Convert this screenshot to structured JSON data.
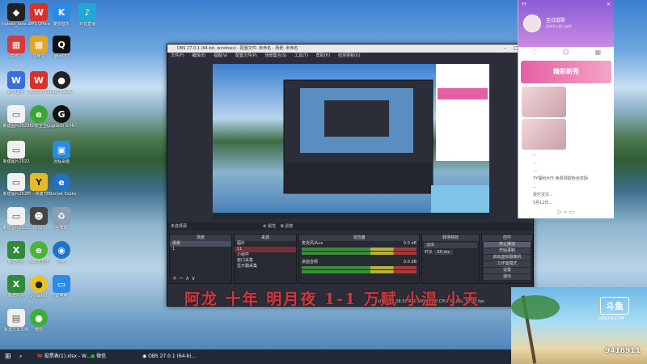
{
  "desktop": {
    "icons": [
      {
        "label": "tiglads_bota...",
        "glyph": "◆",
        "color": "#222222"
      },
      {
        "label": "WPS Office",
        "glyph": "W",
        "color": "#d7312a"
      },
      {
        "label": "酷狗音乐",
        "glyph": "K",
        "color": "#2a8ae6"
      },
      {
        "label": "抖音直播",
        "glyph": "♪",
        "color": "#1fa9d6"
      },
      {
        "label": "在线...",
        "glyph": "▦",
        "color": "#d83a3a"
      },
      {
        "label": "应用宝",
        "glyph": "▦",
        "color": "#e0a52a"
      },
      {
        "label": "腾讯QQ",
        "glyph": "Q",
        "color": "#111111"
      },
      {
        "label": "WPS图片",
        "glyph": "W",
        "color": "#3a6ed8"
      },
      {
        "label": "WPS Office",
        "glyph": "W",
        "color": "#d7312a"
      },
      {
        "label": "OBS Studio",
        "glyph": "●",
        "color": "#222222"
      },
      {
        "label": "新建图片2022",
        "glyph": "▭",
        "color": "#f1f1f1"
      },
      {
        "label": "360安全卫士",
        "glyph": "e",
        "color": "#3ca635"
      },
      {
        "label": "Logitech G HUB",
        "glyph": "G",
        "color": "#111111"
      },
      {
        "label": "新建图片2022",
        "glyph": "▭",
        "color": "#f1f1f1"
      },
      {
        "label": "远程桌面",
        "glyph": "▣",
        "color": "#2a8ae6"
      },
      {
        "label": "新建图片2022",
        "glyph": "▭",
        "color": "#f1f1f1"
      },
      {
        "label": "YY - 快捷方式",
        "glyph": "Y",
        "color": "#e6b92a"
      },
      {
        "label": "Internet Explorer",
        "glyph": "e",
        "color": "#1f72c6"
      },
      {
        "label": "新建图片2022",
        "glyph": "▭",
        "color": "#f1f1f1"
      },
      {
        "label": "Origin",
        "glyph": "☻",
        "color": "#444444"
      },
      {
        "label": "回收站",
        "glyph": "🗑",
        "color": "#8aa0b6"
      },
      {
        "label": "新建图片",
        "glyph": "X",
        "color": "#2e8b3a"
      },
      {
        "label": "360浏览器",
        "glyph": "e",
        "color": "#4ab43a"
      },
      {
        "label": "网络",
        "glyph": "◉",
        "color": "#1f72c6"
      },
      {
        "label": "新建图片",
        "glyph": "X",
        "color": "#2e8b3a"
      },
      {
        "label": "pyramid",
        "glyph": "●",
        "color": "#e6c22a"
      },
      {
        "label": "此电脑",
        "glyph": "▭",
        "color": "#2a8ae6"
      },
      {
        "label": "新建文本文档",
        "glyph": "▤",
        "color": "#f1f1f1"
      },
      {
        "label": "微信",
        "glyph": "●",
        "color": "#3cb034"
      }
    ]
  },
  "obs": {
    "title": "OBS 27.0.1 (64-bit, windows) - 配置文件: 未命名 - 场景: 未命名",
    "menu": [
      "文件(F)",
      "编辑(E)",
      "视图(V)",
      "配置文件(P)",
      "场景集合(S)",
      "工具(T)",
      "帮助(H)",
      "检测更新(U)"
    ],
    "scene_strip": "未选择源",
    "props_btn": "⚙ 属性",
    "filter_btn": "⧉ 滤镜",
    "docks": {
      "scenes": {
        "head": "场景",
        "items": [
          "场景",
          "1"
        ]
      },
      "sources": {
        "head": "来源",
        "items": [
          "图片",
          "11",
          "小组件",
          "窗口采集",
          "显示器采集"
        ]
      },
      "mixer": {
        "head": "混音器",
        "channels": [
          {
            "name": "麦克风/Aux",
            "db": "0.0 dB"
          },
          {
            "name": "桌面音频",
            "db": "0.0 dB"
          }
        ]
      },
      "transitions": {
        "head": "转场特效",
        "type": "淡出",
        "duration_label": "时长",
        "duration": "50 ms"
      },
      "controls": {
        "head": "控件",
        "buttons": [
          "停止推流",
          "开始录制",
          "启动虚拟摄像机",
          "工作室模式",
          "设置",
          "退出"
        ]
      }
    },
    "status": "LIVE: 00:28:38   REC: 00:00:00   CPU: 39.8%, 30.00 fps"
  },
  "overlay": {
    "text": "阿龙 十年 明月夜 1-1 万赋 小温 小天"
  },
  "yy": {
    "label": "YY",
    "user": "圣战道歌",
    "status": "愿余生心愿人安好",
    "banner": "精彩新秀",
    "rows": [
      "...",
      "...",
      "...",
      "YY福利大厅-免费领取粉丝奖励",
      "...",
      "悦乐宝贝...",
      "5月12日...",
      "...",
      "..."
    ]
  },
  "douyu": {
    "logo": "斗鱼",
    "sub": "DOUYU.COM",
    "room": "9418911"
  },
  "taskbar": {
    "items": [
      "投票表(1).xlsx - W...",
      "微信",
      "OBS 27.0.1 (64-bi..."
    ]
  }
}
